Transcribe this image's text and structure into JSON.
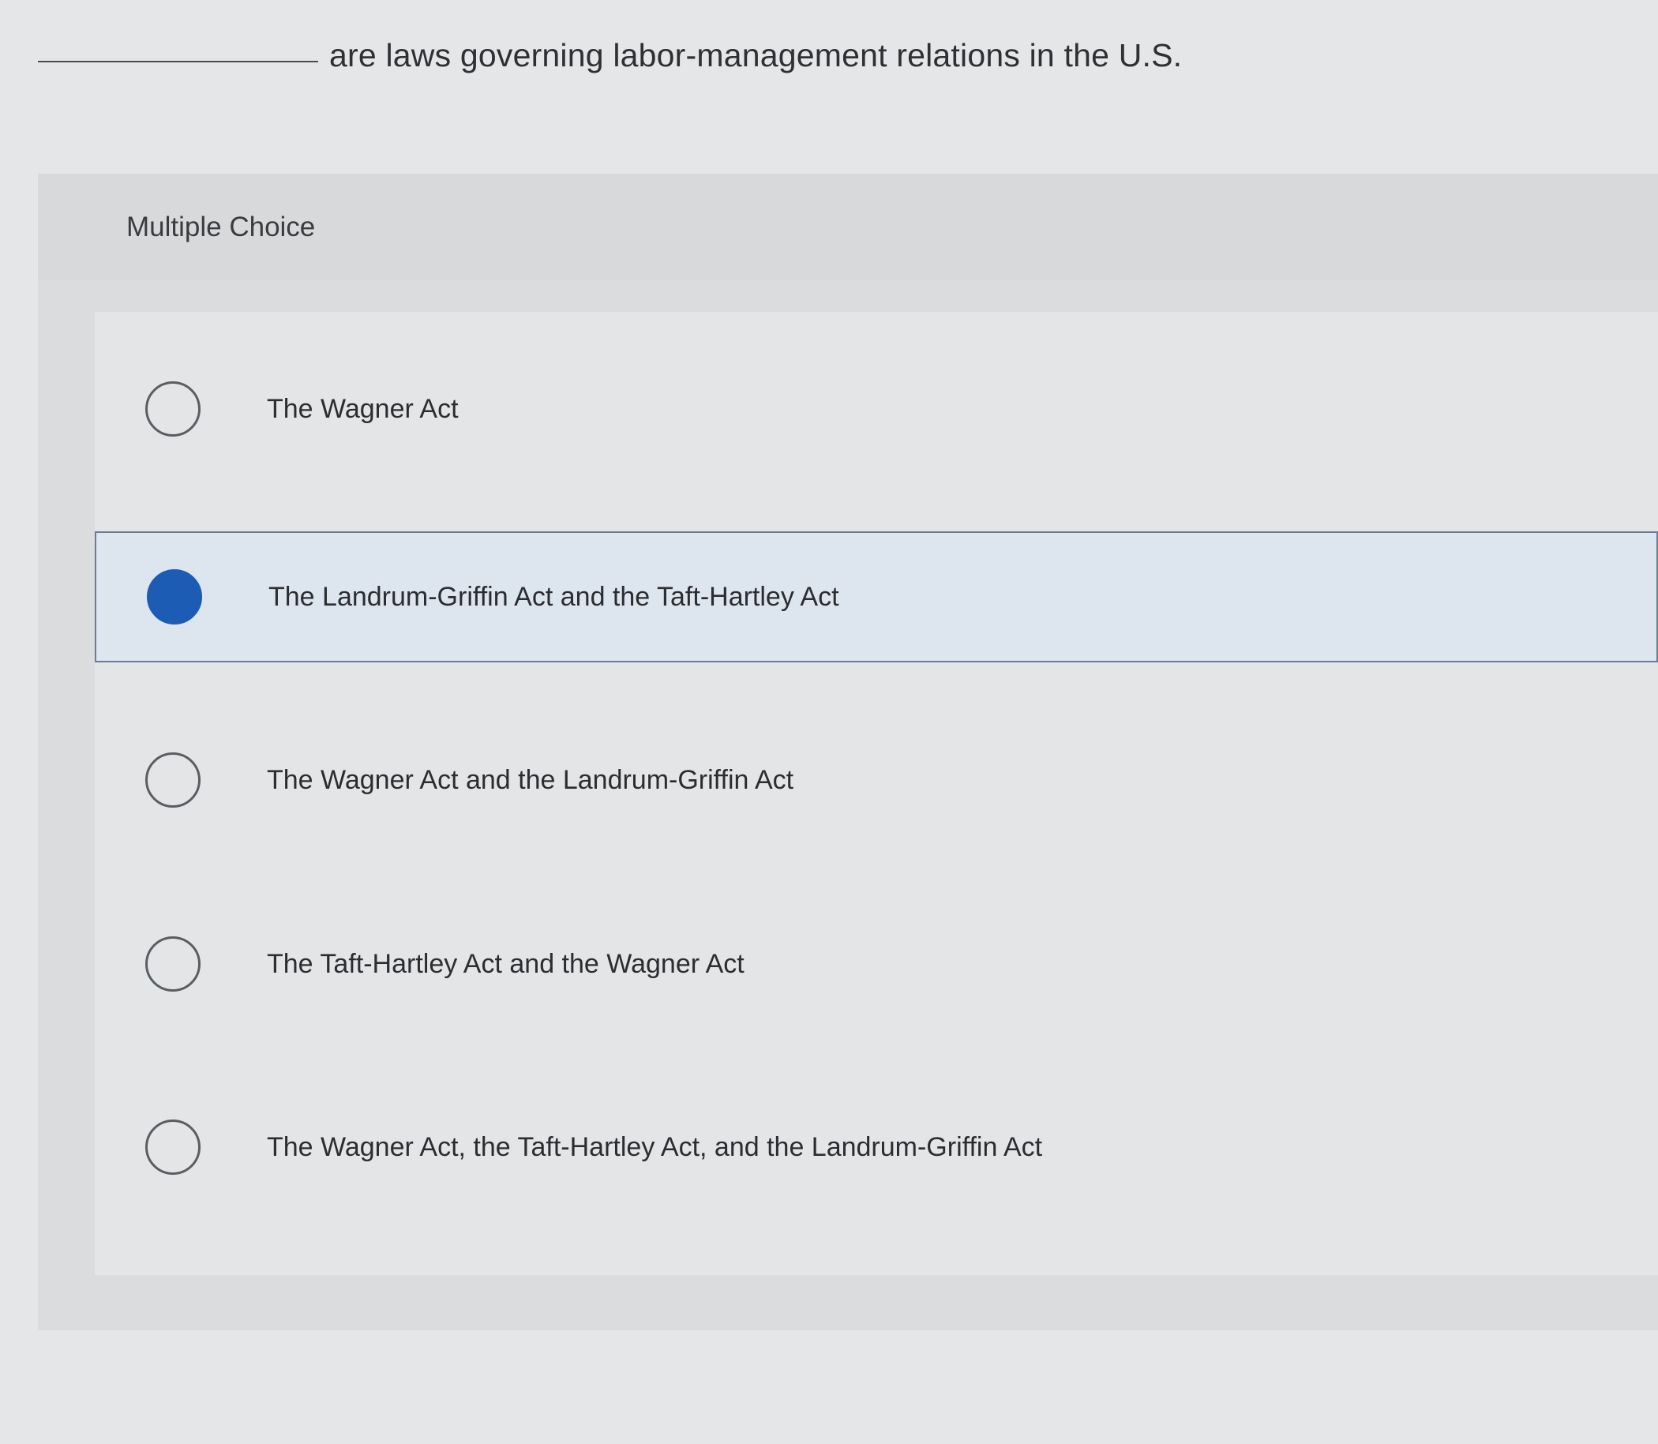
{
  "question": {
    "text": "are laws governing labor-management relations in the U.S."
  },
  "section_label": "Multiple Choice",
  "choices": [
    {
      "label": "The Wagner Act",
      "selected": false
    },
    {
      "label": "The Landrum-Griffin Act and the Taft-Hartley Act",
      "selected": true
    },
    {
      "label": "The Wagner Act and the Landrum-Griffin Act",
      "selected": false
    },
    {
      "label": "The Taft-Hartley Act and the Wagner Act",
      "selected": false
    },
    {
      "label": "The Wagner Act, the Taft-Hartley Act, and the Landrum-Griffin Act",
      "selected": false
    }
  ],
  "colors": {
    "selected_radio": "#1d5cb4",
    "selected_background": "#dde5ee",
    "selected_border": "#6a7d94"
  }
}
